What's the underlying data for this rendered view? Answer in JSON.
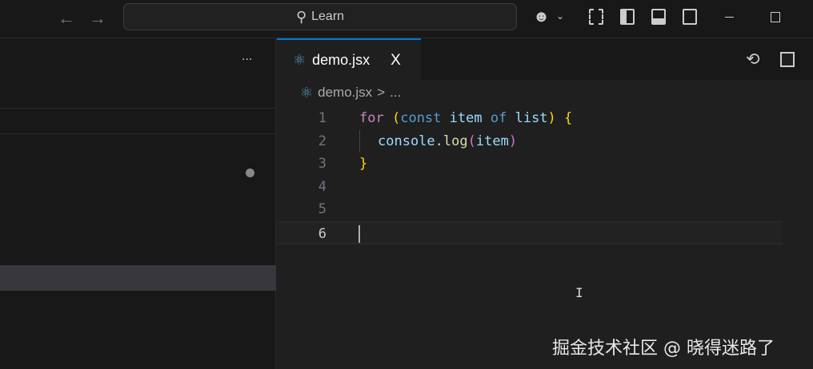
{
  "titlebar": {
    "search_label": "Learn"
  },
  "tab": {
    "label": "demo.jsx",
    "close": "X"
  },
  "breadcrumb": {
    "file": "demo.jsx",
    "sep": ">",
    "more": "..."
  },
  "sidebar": {
    "more": "..."
  },
  "editor": {
    "lines": [
      {
        "n": "1"
      },
      {
        "n": "2"
      },
      {
        "n": "3"
      },
      {
        "n": "4"
      },
      {
        "n": "5"
      },
      {
        "n": "6"
      }
    ],
    "tokens": {
      "for": "for",
      "lp": "(",
      "const": "const",
      "item": "item",
      "of": "of",
      "list": "list",
      "rp": ")",
      "lb": "{",
      "console": "console.",
      "log": "log",
      "lp2": "(",
      "item2": "item",
      "rp2": ")",
      "rb": "}"
    }
  },
  "watermark": "掘金技术社区 @ 晓得迷路了"
}
